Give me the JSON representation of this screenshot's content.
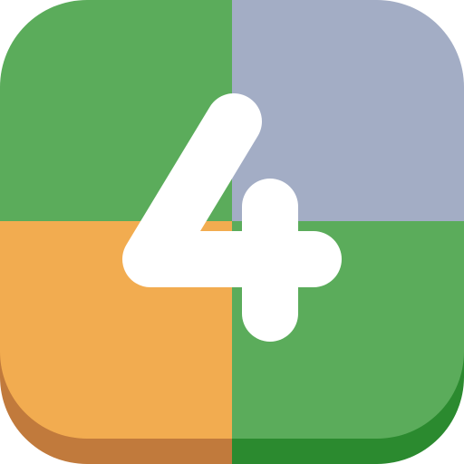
{
  "app_icon": {
    "glyph": "4",
    "glyph_color": "#ffffff",
    "quadrant_colors": {
      "top_left": "#5bac5b",
      "top_right": "#a3adc5",
      "bottom_left": "#f2ac50",
      "bottom_right": "#5bac5b"
    },
    "base_colors": {
      "left": "#c17a3c",
      "right": "#2b8a2f"
    }
  }
}
